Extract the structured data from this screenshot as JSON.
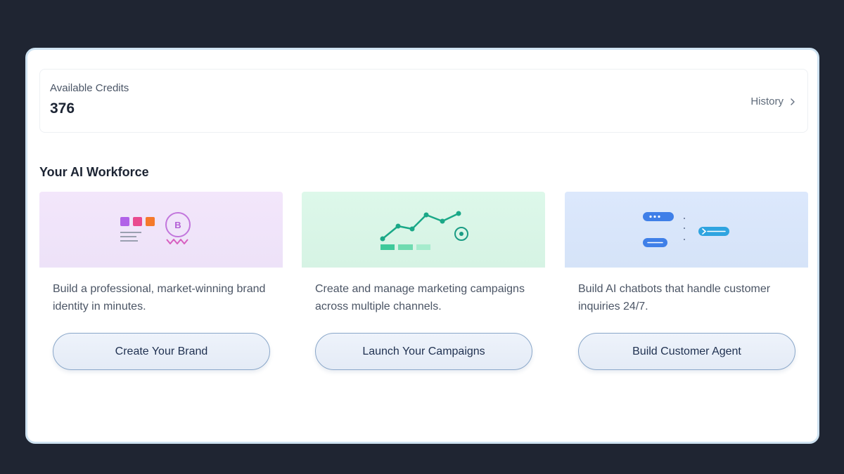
{
  "credits": {
    "label": "Available Credits",
    "value": "376",
    "history_label": "History"
  },
  "section": {
    "title": "Your AI Workforce"
  },
  "cards": [
    {
      "illustration": "brand-identity-illustration",
      "banner_color": "#f0e3fa",
      "badge_letter": "B",
      "description": "Build a professional, market-winning brand identity in minutes.",
      "button_label": "Create Your Brand"
    },
    {
      "illustration": "campaign-growth-illustration",
      "banner_color": "#dcf6e8",
      "description": "Create and manage marketing campaigns across multiple channels.",
      "button_label": "Launch Your Campaigns"
    },
    {
      "illustration": "chatbot-conversation-illustration",
      "banner_color": "#dce8fb",
      "description": "Build AI chatbots that handle customer inquiries 24/7.",
      "button_label": "Build Customer Agent"
    }
  ]
}
